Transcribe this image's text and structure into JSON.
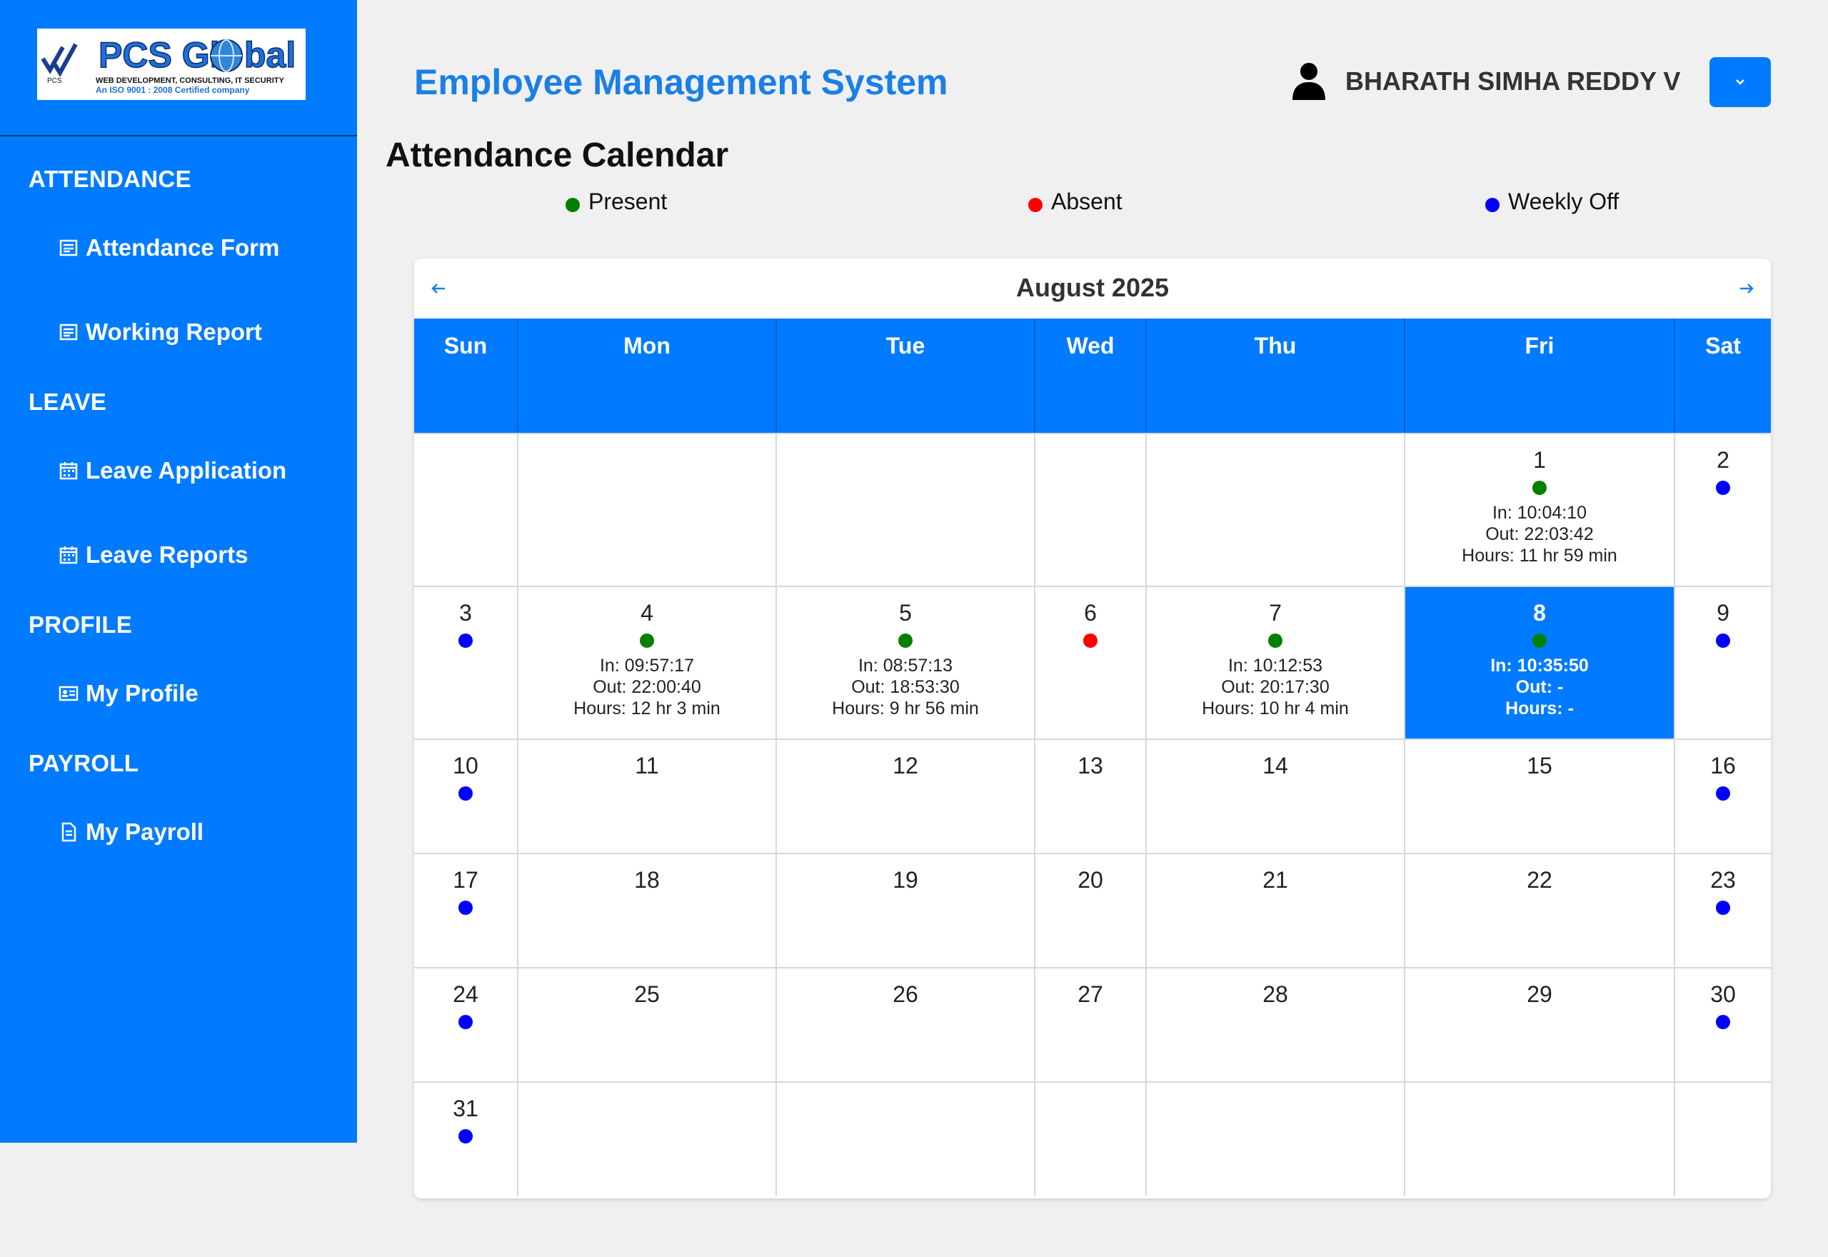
{
  "app": {
    "title": "Employee Management System"
  },
  "logo": {
    "brand": "PCS Global",
    "tag": "WEB DEVELOPMENT, CONSULTING, IT SECURITY",
    "cert": "An ISO 9001 : 2008 Certified company",
    "mark": "PCS"
  },
  "user": {
    "name": "BHARATH SIMHA REDDY V",
    "icon": "user-icon",
    "dropdown_icon": "chevron-down-icon"
  },
  "sidebar": {
    "sections": [
      {
        "label": "ATTENDANCE",
        "items": [
          {
            "label": "Attendance Form",
            "icon": "form-icon"
          },
          {
            "label": "Working Report",
            "icon": "form-icon"
          }
        ]
      },
      {
        "label": "LEAVE",
        "items": [
          {
            "label": "Leave Application",
            "icon": "calendar-icon"
          },
          {
            "label": "Leave Reports",
            "icon": "calendar-icon"
          }
        ]
      },
      {
        "label": "PROFILE",
        "items": [
          {
            "label": "My Profile",
            "icon": "id-card-icon"
          }
        ]
      },
      {
        "label": "PAYROLL",
        "items": [
          {
            "label": "My Payroll",
            "icon": "document-icon"
          }
        ]
      }
    ]
  },
  "page": {
    "heading": "Attendance Calendar"
  },
  "legend": [
    {
      "label": "Present",
      "color": "#008000"
    },
    {
      "label": "Absent",
      "color": "#ff0000"
    },
    {
      "label": "Weekly Off",
      "color": "#0000ff"
    }
  ],
  "calendar": {
    "month": "August 2025",
    "prev_icon": "arrow-left-icon",
    "next_icon": "arrow-right-icon",
    "weekdays": [
      "Sun",
      "Mon",
      "Tue",
      "Wed",
      "Thu",
      "Fri",
      "Sat"
    ],
    "today": 8,
    "weeks": [
      [
        null,
        null,
        null,
        null,
        null,
        {
          "day": "1",
          "status": "present",
          "in": "In: 10:04:10",
          "out": "Out: 22:03:42",
          "hours": "Hours: 11 hr 59 min"
        },
        {
          "day": "2",
          "status": "off"
        }
      ],
      [
        {
          "day": "3",
          "status": "off"
        },
        {
          "day": "4",
          "status": "present",
          "in": "In: 09:57:17",
          "out": "Out: 22:00:40",
          "hours": "Hours: 12 hr 3 min"
        },
        {
          "day": "5",
          "status": "present",
          "in": "In: 08:57:13",
          "out": "Out: 18:53:30",
          "hours": "Hours: 9 hr 56 min"
        },
        {
          "day": "6",
          "status": "absent"
        },
        {
          "day": "7",
          "status": "present",
          "in": "In: 10:12:53",
          "out": "Out: 20:17:30",
          "hours": "Hours: 10 hr 4 min"
        },
        {
          "day": "8",
          "status": "present",
          "in": "In: 10:35:50",
          "out": "Out: -",
          "hours": "Hours: -",
          "today": true
        },
        {
          "day": "9",
          "status": "off"
        }
      ],
      [
        {
          "day": "10",
          "status": "off"
        },
        {
          "day": "11"
        },
        {
          "day": "12"
        },
        {
          "day": "13"
        },
        {
          "day": "14"
        },
        {
          "day": "15"
        },
        {
          "day": "16",
          "status": "off"
        }
      ],
      [
        {
          "day": "17",
          "status": "off"
        },
        {
          "day": "18"
        },
        {
          "day": "19"
        },
        {
          "day": "20"
        },
        {
          "day": "21"
        },
        {
          "day": "22"
        },
        {
          "day": "23",
          "status": "off"
        }
      ],
      [
        {
          "day": "24",
          "status": "off"
        },
        {
          "day": "25"
        },
        {
          "day": "26"
        },
        {
          "day": "27"
        },
        {
          "day": "28"
        },
        {
          "day": "29"
        },
        {
          "day": "30",
          "status": "off"
        }
      ],
      [
        {
          "day": "31",
          "status": "off"
        },
        null,
        null,
        null,
        null,
        null,
        null
      ]
    ]
  }
}
